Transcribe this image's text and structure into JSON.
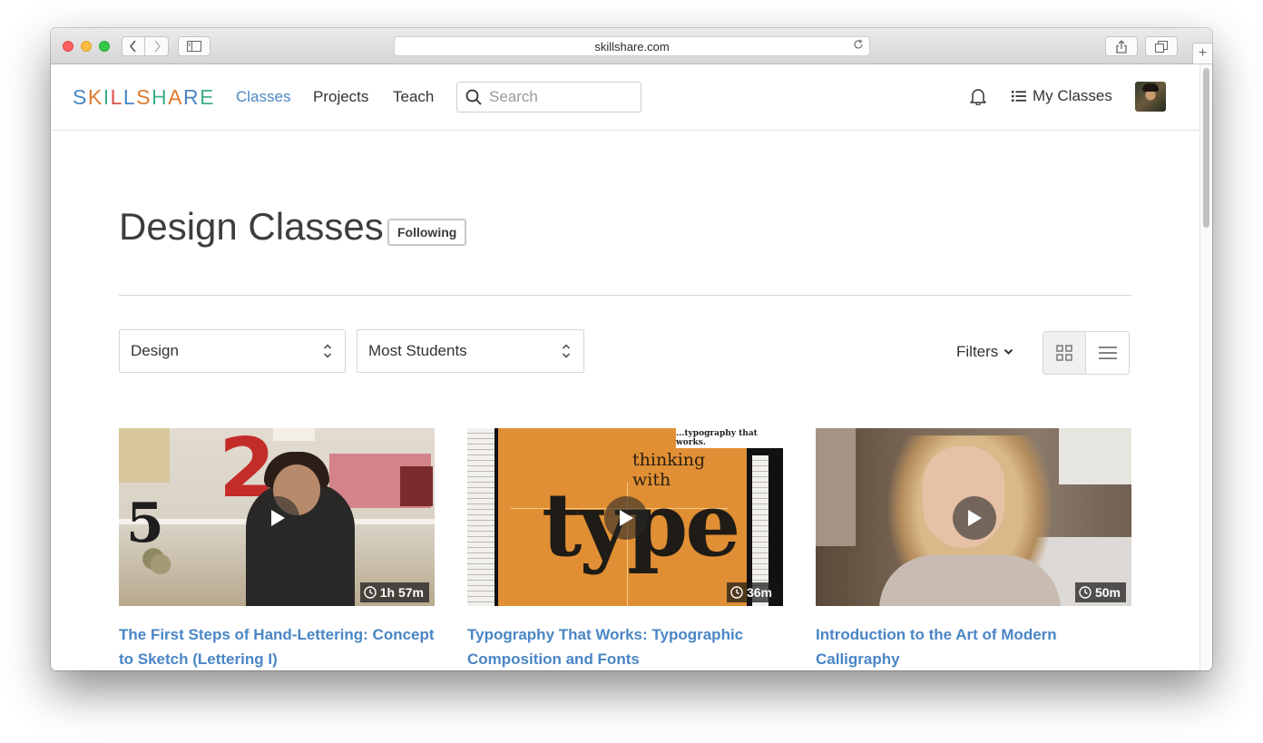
{
  "browser": {
    "url": "skillshare.com",
    "new_tab_label": "+"
  },
  "nav": {
    "logo": "SKILLSHARE",
    "links": [
      "Classes",
      "Projects",
      "Teach"
    ],
    "active_link": "Classes",
    "search_placeholder": "Search",
    "my_classes": "My Classes"
  },
  "header": {
    "title": "Design Classes",
    "follow_label": "Following"
  },
  "controls": {
    "category_select": "Design",
    "sort_select": "Most Students",
    "filters_label": "Filters",
    "active_view": "grid"
  },
  "classes": [
    {
      "title": "The First Steps of Hand-Lettering: Concept to Sketch (Lettering I)",
      "duration": "1h 57m"
    },
    {
      "title": "Typography That Works: Typographic Composition and Fonts",
      "duration": "36m",
      "thumb_text": {
        "tagline": "...typography that works.",
        "line1": "thinking",
        "line2": "with",
        "big": "type"
      }
    },
    {
      "title": "Introduction to the Art of Modern Calligraphy",
      "duration": "50m"
    }
  ],
  "colors": {
    "link_blue": "#4a86c5",
    "logo_colors": [
      "#4a86c5",
      "#e07a2f",
      "#3fae8d",
      "#d9534f"
    ]
  }
}
